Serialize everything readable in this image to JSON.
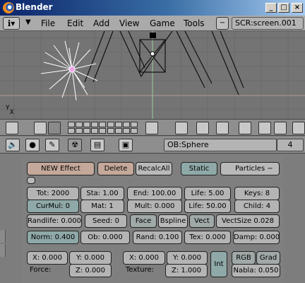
{
  "window": {
    "title": "Blender",
    "controls": [
      "_",
      "□",
      "×"
    ]
  },
  "menubar": {
    "items": [
      "File",
      "Edit",
      "Add",
      "View",
      "Game",
      "Tools"
    ],
    "screen": "SCR:screen.001",
    "screen_minus": "−"
  },
  "buttons_header": {
    "object_name": "OB:Sphere",
    "frame": "4"
  },
  "effect": {
    "new_effect": "NEW Effect",
    "delete": "Delete",
    "recalc_all": "RecalcAll",
    "static": "Static",
    "type": "Particles",
    "type_minus": "−"
  },
  "row1": {
    "tot": "Tot: 2000",
    "sta": "Sta: 1.00",
    "end": "End: 100.00",
    "life": "Life: 5.00",
    "keys": "Keys: 8"
  },
  "row2": {
    "curmul": "CurMul: 0",
    "mat": "Mat: 1",
    "mult": "Mult: 0.000",
    "life": "Life: 50.00",
    "child": "Child: 4"
  },
  "row3": {
    "randlife": "Randlife: 0.000",
    "seed": "Seed: 0",
    "face": "Face",
    "bspline": "Bspline",
    "vect": "Vect",
    "vectsize": "VectSize 0.028"
  },
  "row4": {
    "norm": "Norm: 0.400",
    "ob": "Ob: 0.000",
    "rand": "Rand: 0.100",
    "tex": "Tex: 0.000",
    "damp": "Damp: 0.000"
  },
  "force": {
    "label": "Force:",
    "x": "X: 0.000",
    "y": "Y: 0.000",
    "z": "Z: 0.000"
  },
  "texture": {
    "label": "Texture:",
    "x": "X: 0.000",
    "y": "Y: 0.000",
    "z": "Z: 1.000",
    "int": "Int",
    "rgb": "RGB",
    "grad": "Grad",
    "nabla": "Nabla: 0.050"
  },
  "viewport": {
    "axis_y": "Y",
    "axis_x": "X"
  },
  "colors": {
    "title_start": "#0a246a",
    "title_end": "#a6caf0",
    "viewport_bg": "#747474",
    "grid": "#6a6a6a"
  }
}
